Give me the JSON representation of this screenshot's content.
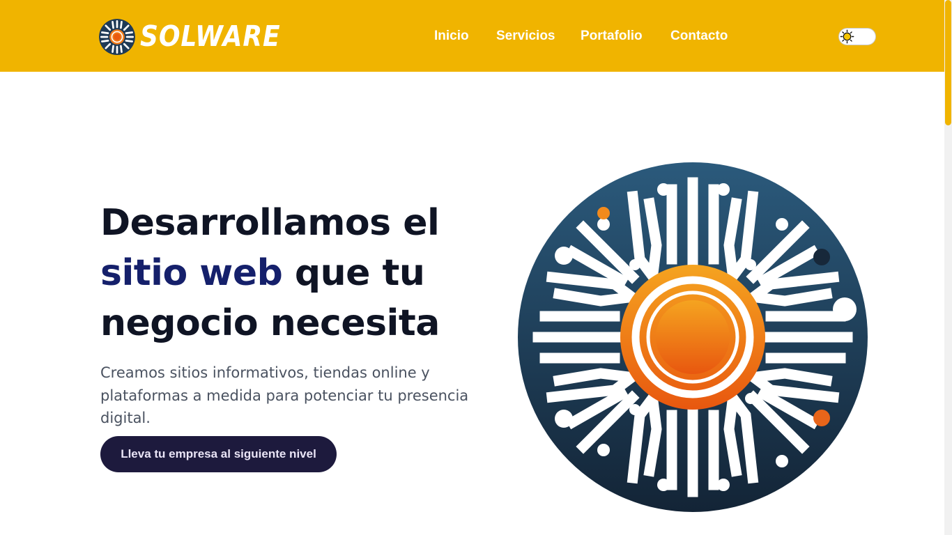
{
  "brand": {
    "name": "SOLWARE",
    "logo_icon": "circuit-sun-logo",
    "colors": {
      "header_bg": "#f0b400",
      "accent_text": "#15206b",
      "cta_bg": "#1d1a3d",
      "sun_orange": "#f07b1a",
      "circuit_navy": "#1f3a56"
    }
  },
  "nav": {
    "items": [
      {
        "label": "Inicio"
      },
      {
        "label": "Servicios"
      },
      {
        "label": "Portafolio"
      },
      {
        "label": "Contacto"
      }
    ]
  },
  "theme_toggle": {
    "icon": "sun-icon",
    "state": "light"
  },
  "hero": {
    "title_part1": "Desarrollamos el ",
    "title_accent": "sitio web",
    "title_part2": " que tu negocio necesita",
    "subtitle": "Creamos sitios informativos, tiendas online y plataformas a medida para potenciar tu presencia digital.",
    "cta_label": "Lleva tu empresa al siguiente nivel",
    "illustration": "circuit-sun-illustration"
  }
}
